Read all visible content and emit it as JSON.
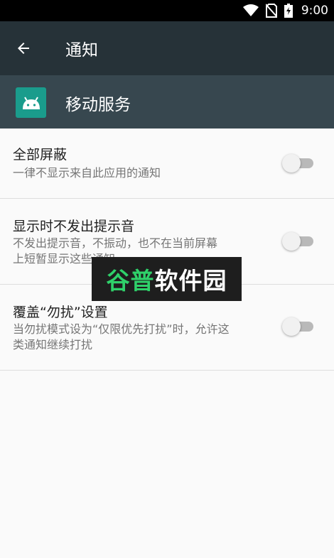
{
  "status_bar": {
    "time": "9:00",
    "icons": [
      "wifi-icon",
      "no-sim-icon",
      "battery-charging-icon"
    ]
  },
  "toolbar": {
    "back_icon": "arrow-back-icon",
    "title": "通知"
  },
  "app_header": {
    "icon": "android-icon",
    "name": "移动服务"
  },
  "settings": [
    {
      "title": "全部屏蔽",
      "summary": "一律不显示来自此应用的通知",
      "enabled": false
    },
    {
      "title": "显示时不发出提示音",
      "summary_line1": "不发出提示音，不振动，也不在当前屏幕",
      "summary_line2": "上短暂显示这些通知。",
      "enabled": false
    },
    {
      "title": "覆盖“勿扰”设置",
      "summary_line1": "当勿扰模式设为“仅限优先打扰”时，允许这",
      "summary_line2": "类通知继续打扰",
      "enabled": false
    }
  ],
  "watermark": {
    "part1": "谷普",
    "part2": "软件园"
  }
}
